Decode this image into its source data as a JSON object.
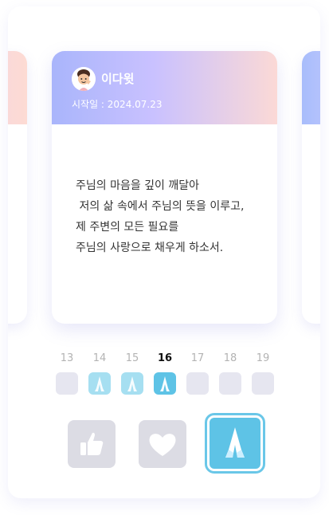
{
  "card": {
    "author": "이다윗",
    "start_date": "시작일 : 2024.07.23",
    "prayer_text": "주님의 마음을 깊이 깨달아\n 저의 삶 속에서 주님의 뜻을 이루고,\n제 주변의 모든 필요를\n주님의 사랑으로 채우게 하소서."
  },
  "days": [
    {
      "label": "13",
      "state": "empty"
    },
    {
      "label": "14",
      "state": "done"
    },
    {
      "label": "15",
      "state": "done"
    },
    {
      "label": "16",
      "state": "today"
    },
    {
      "label": "17",
      "state": "empty"
    },
    {
      "label": "18",
      "state": "empty"
    },
    {
      "label": "19",
      "state": "empty"
    }
  ],
  "actions": [
    {
      "name": "like",
      "icon": "thumbs-up-icon"
    },
    {
      "name": "heart",
      "icon": "heart-icon"
    },
    {
      "name": "pray",
      "icon": "praying-hands-icon",
      "selected": true
    }
  ],
  "colors": {
    "accent": "#5ec3e6",
    "accent_light": "#a6dff1",
    "inactive": "#dcdce4",
    "day_empty": "#e6e6f0"
  }
}
